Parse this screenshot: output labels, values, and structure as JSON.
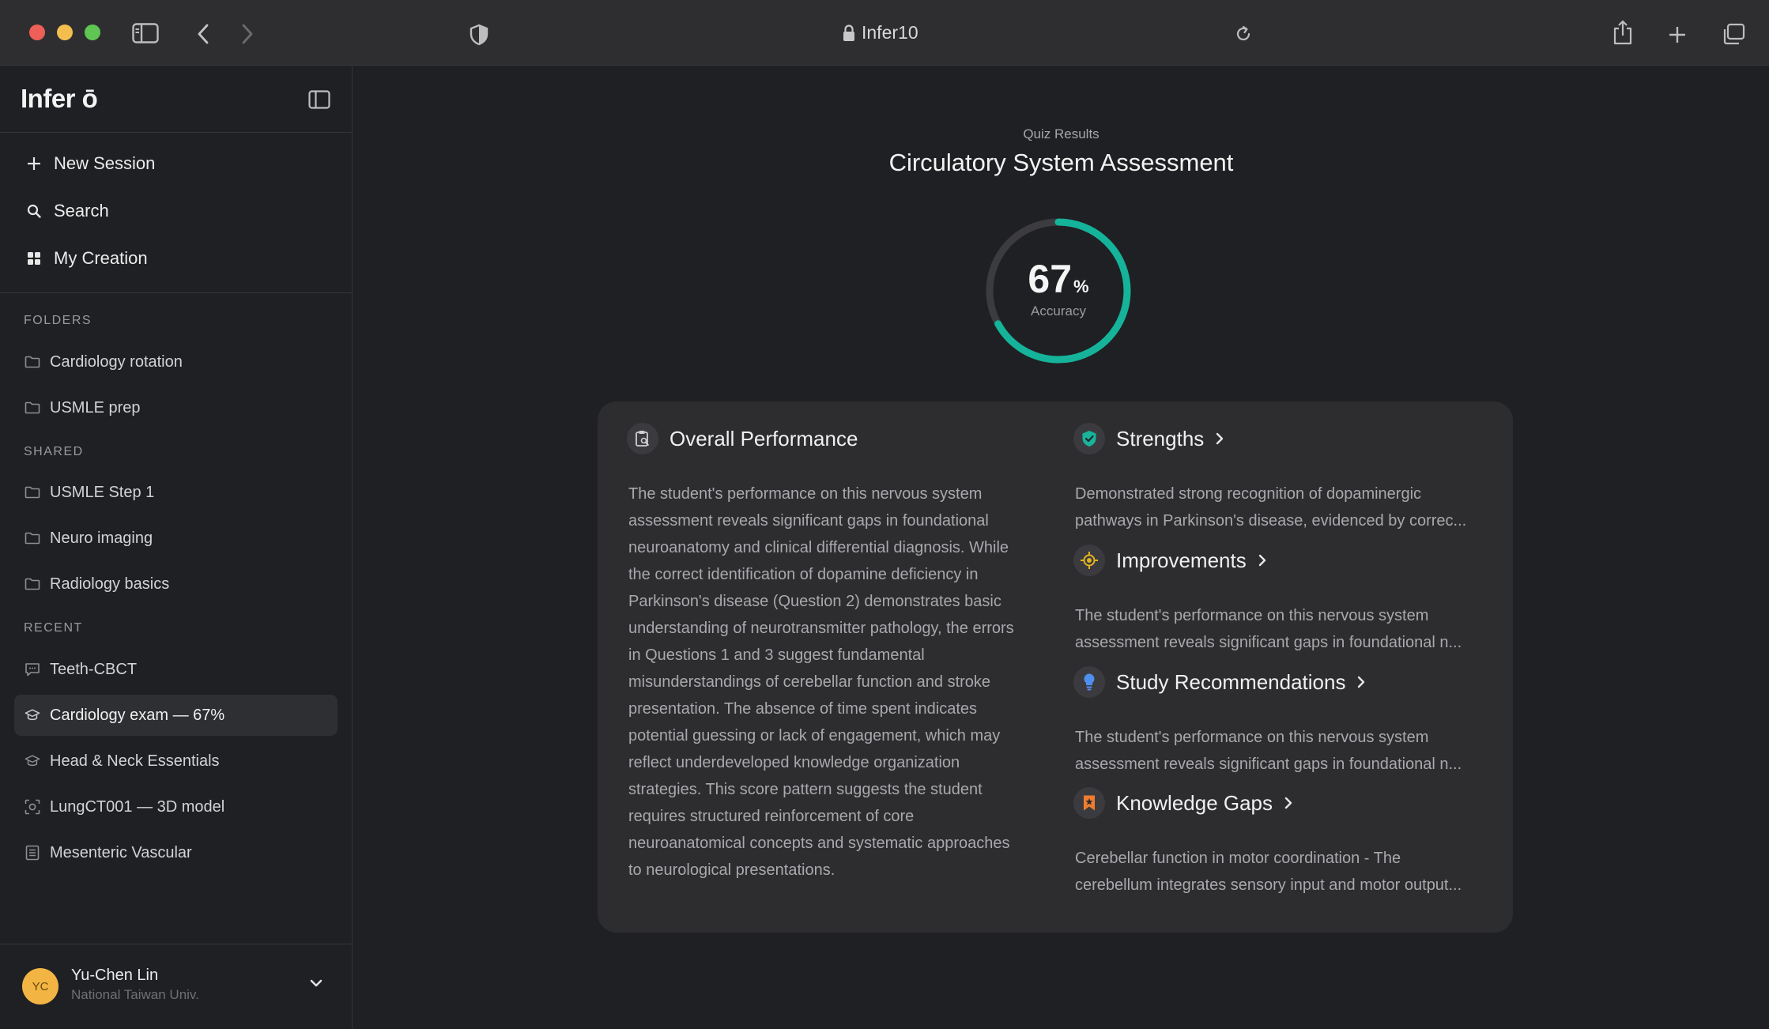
{
  "browser": {
    "url": "Infer10",
    "colors": {
      "close": "#ed5f57",
      "minimize": "#f4be4f",
      "zoom": "#5fc553"
    }
  },
  "sidebar": {
    "brand": "Infer ō",
    "actions": [
      {
        "label": "New Session",
        "icon": "plus-icon"
      },
      {
        "label": "Search",
        "icon": "search-icon"
      },
      {
        "label": "My Creation",
        "icon": "grid-icon"
      }
    ],
    "folders_label": "FOLDERS",
    "folders": [
      "Cardiology rotation",
      "USMLE prep"
    ],
    "shared_label": "SHARED",
    "shared": [
      "USMLE Step 1",
      "Neuro imaging",
      "Radiology basics"
    ],
    "recent_label": "RECENT",
    "recent": [
      {
        "label": "Teeth-CBCT",
        "icon": "chat-icon"
      },
      {
        "label": "Cardiology exam — 67%",
        "icon": "graduation-cap-icon",
        "active": true
      },
      {
        "label": "Head & Neck Essentials",
        "icon": "graduation-cap-icon"
      },
      {
        "label": "LungCT001 — 3D model",
        "icon": "3d-scan-icon"
      },
      {
        "label": "Mesenteric Vascular",
        "icon": "document-list-icon"
      }
    ],
    "user": {
      "initials": "YC",
      "name": "Yu-Chen Lin",
      "org": "National Taiwan Univ."
    }
  },
  "quiz": {
    "subtitle": "Quiz Results",
    "title": "Circulatory System Assessment",
    "accuracy": 67,
    "accuracy_unit": "%",
    "accuracy_label": "Accuracy",
    "accent": "#14b39a"
  },
  "overall": {
    "title": "Overall Performance",
    "lines": [
      "The student's performance on this nervous system",
      "assessment reveals significant gaps in foundational",
      "neuroanatomy and clinical differential diagnosis. While",
      "the correct identification of dopamine deficiency in",
      "Parkinson's disease (Question 2) demonstrates basic",
      "understanding of neurotransmitter pathology, the errors",
      "in Questions 1 and 3 suggest fundamental",
      "misunderstandings of cerebellar function and stroke",
      "presentation. The absence of time spent indicates",
      "potential guessing or lack of engagement, which may",
      "reflect underdeveloped knowledge organization",
      "strategies. This score pattern suggests the student",
      "requires structured reinforcement of core",
      "neuroanatomical concepts and systematic approaches",
      "to neurological presentations."
    ]
  },
  "insights": [
    {
      "title": "Strengths",
      "icon": "shield-check-icon",
      "color": "#18b39b",
      "line1": "Demonstrated strong recognition of dopaminergic",
      "line2": "pathways in Parkinson's disease, evidenced by correc..."
    },
    {
      "title": "Improvements",
      "icon": "target-icon",
      "color": "#e0b421",
      "line1": "The student's performance on this nervous system",
      "line2": "assessment reveals significant gaps in foundational n..."
    },
    {
      "title": "Study Recommendations",
      "icon": "lightbulb-icon",
      "color": "#4f8ff0",
      "line1": "The student's performance on this nervous system",
      "line2": "assessment reveals significant gaps in foundational n..."
    },
    {
      "title": "Knowledge Gaps",
      "icon": "bookmark-icon",
      "color": "#ef7d2e",
      "line1": "Cerebellar function in motor coordination - The",
      "line2": "cerebellum integrates sensory input and motor output..."
    }
  ]
}
